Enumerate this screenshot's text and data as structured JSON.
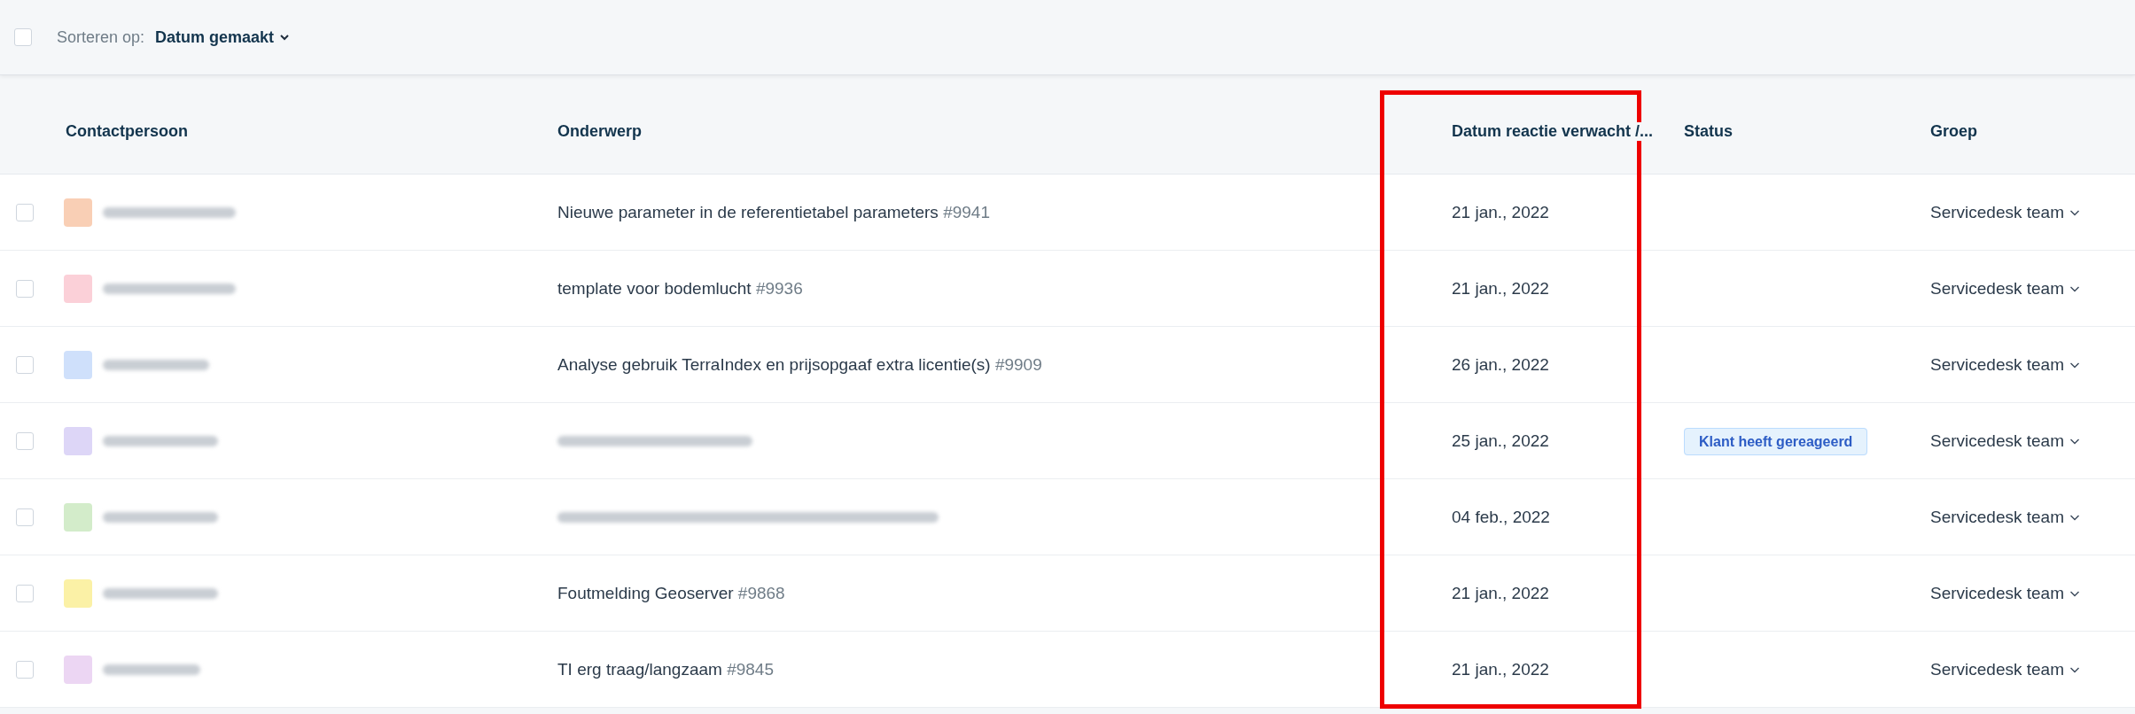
{
  "toolbar": {
    "select_all": {
      "checked": false
    },
    "sort_label": "Sorteren op:",
    "sort_value": "Datum gemaakt"
  },
  "table": {
    "columns": [
      "Contactpersoon",
      "Onderwerp",
      "Datum reactie verwacht /...",
      "Status",
      "Groep"
    ],
    "rows": [
      {
        "checked": false,
        "color": "#f9cfb5",
        "subject": {
          "kind": "text",
          "title": "Nieuwe parameter in de referentietabel parameters",
          "number": "#9941"
        },
        "date": "21 jan., 2022",
        "group": "Servicedesk team"
      },
      {
        "checked": false,
        "color": "#fbd0d8",
        "subject": {
          "kind": "text",
          "title": "template voor bodemlucht",
          "number": "#9936"
        },
        "date": "21 jan., 2022",
        "group": "Servicedesk team"
      },
      {
        "checked": false,
        "color": "#cfe0fb",
        "subject": {
          "kind": "text",
          "title": "Analyse gebruik TerraIndex en prijsopgaaf extra licentie(s)",
          "number": "#9909"
        },
        "date": "26 jan., 2022",
        "group": "Servicedesk team"
      },
      {
        "checked": false,
        "color": "#ddd6f7",
        "subject": {
          "kind": "blurred"
        },
        "date": "25 jan., 2022",
        "status": "Klant heeft gereageerd",
        "group": "Servicedesk team"
      },
      {
        "checked": false,
        "color": "#d3ecca",
        "subject": {
          "kind": "blurred"
        },
        "date": "04 feb., 2022",
        "group": "Servicedesk team"
      },
      {
        "checked": false,
        "color": "#fbf1a6",
        "subject": {
          "kind": "text",
          "title": "Foutmelding Geoserver",
          "number": "#9868"
        },
        "date": "21 jan., 2022",
        "group": "Servicedesk team"
      },
      {
        "checked": false,
        "color": "#ecd6f3",
        "subject": {
          "kind": "text",
          "title": "TI erg traag/langzaam",
          "number": "#9845"
        },
        "date": "21 jan., 2022",
        "group": "Servicedesk team"
      }
    ]
  }
}
